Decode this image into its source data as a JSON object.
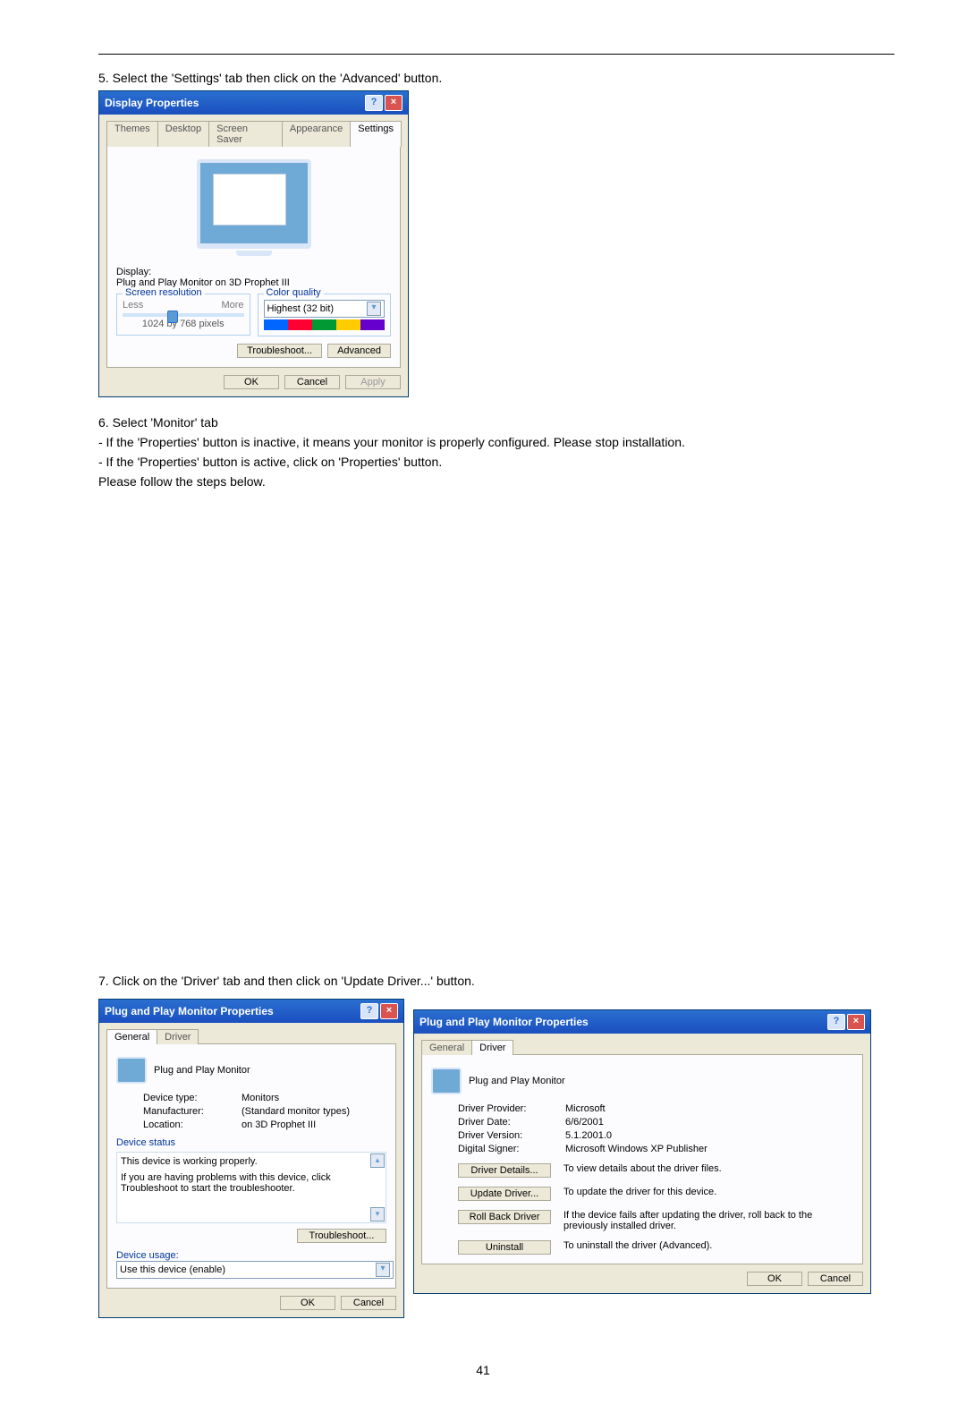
{
  "step5": {
    "text": "5. Select the 'Settings' tab then click on the 'Advanced' button."
  },
  "display_dialog": {
    "title": "Display Properties",
    "tabs": {
      "themes": "Themes",
      "desktop": "Desktop",
      "screensaver": "Screen Saver",
      "appearance": "Appearance",
      "settings": "Settings"
    },
    "display_label": "Display:",
    "display_value": "Plug and Play Monitor on 3D Prophet III",
    "screen_res_legend": "Screen resolution",
    "less": "Less",
    "more": "More",
    "res_value": "1024 by 768 pixels",
    "color_legend": "Color quality",
    "color_value": "Highest (32 bit)",
    "troubleshoot": "Troubleshoot...",
    "advanced": "Advanced",
    "ok": "OK",
    "cancel": "Cancel",
    "apply": "Apply"
  },
  "step6": {
    "line1": "6. Select 'Monitor' tab",
    "line2": "- If the 'Properties' button is inactive, it means your monitor is properly configured. Please stop installation.",
    "line3": "- If the 'Properties' button is active, click on 'Properties' button.",
    "line4": "Please follow the steps below."
  },
  "step7": {
    "text": "7. Click on the 'Driver' tab and then click on 'Update Driver...' button."
  },
  "general_dialog": {
    "title": "Plug and Play Monitor Properties",
    "tab_general": "General",
    "tab_driver": "Driver",
    "device_name": "Plug and Play Monitor",
    "device_type_label": "Device type:",
    "device_type_value": "Monitors",
    "manufacturer_label": "Manufacturer:",
    "manufacturer_value": "(Standard monitor types)",
    "location_label": "Location:",
    "location_value": "on 3D Prophet III",
    "device_status_label": "Device status",
    "status_working": "This device is working properly.",
    "status_help": "If you are having problems with this device, click Troubleshoot to start the troubleshooter.",
    "troubleshoot": "Troubleshoot...",
    "usage_label": "Device usage:",
    "usage_value": "Use this device (enable)",
    "ok": "OK",
    "cancel": "Cancel"
  },
  "driver_dialog": {
    "title": "Plug and Play Monitor Properties",
    "tab_general": "General",
    "tab_driver": "Driver",
    "device_name": "Plug and Play Monitor",
    "provider_label": "Driver Provider:",
    "provider_value": "Microsoft",
    "date_label": "Driver Date:",
    "date_value": "6/6/2001",
    "version_label": "Driver Version:",
    "version_value": "5.1.2001.0",
    "signer_label": "Digital Signer:",
    "signer_value": "Microsoft Windows XP Publisher",
    "details_btn": "Driver Details...",
    "details_desc": "To view details about the driver files.",
    "update_btn": "Update Driver...",
    "update_desc": "To update the driver for this device.",
    "rollback_btn": "Roll Back Driver",
    "rollback_desc": "If the device fails after updating the driver, roll back to the previously installed driver.",
    "uninstall_btn": "Uninstall",
    "uninstall_desc": "To uninstall the driver (Advanced).",
    "ok": "OK",
    "cancel": "Cancel"
  },
  "page_number": "41"
}
